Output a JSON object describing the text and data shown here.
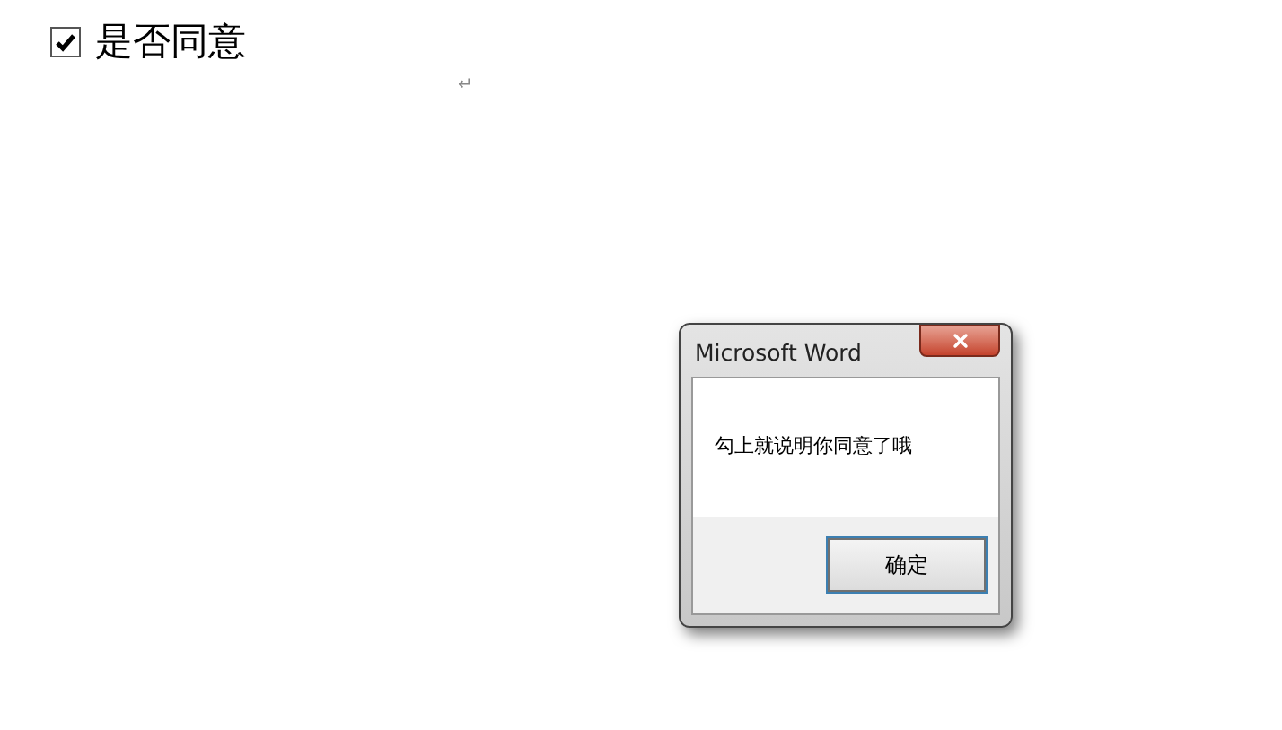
{
  "document": {
    "checkbox": {
      "label": "是否同意",
      "checked": true
    },
    "paragraph_mark": "↵"
  },
  "dialog": {
    "title": "Microsoft Word",
    "message": "勾上就说明你同意了哦",
    "buttons": [
      "确定"
    ]
  }
}
